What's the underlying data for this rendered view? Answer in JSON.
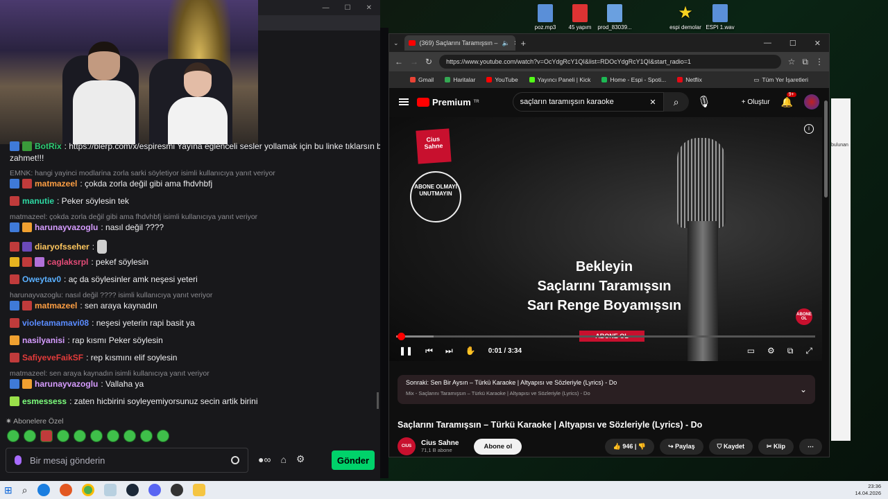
{
  "desktop_icons": [
    {
      "label": "poz.mp3",
      "color": "#5a8fd8"
    },
    {
      "label": "45 yapım",
      "color": "#d33"
    },
    {
      "label": "prod_83039...",
      "color": "#6aa0e0"
    },
    {
      "label": "espi demolar",
      "color": "#f5d020"
    },
    {
      "label": "ESPI 1.wav",
      "color": "#5a8fd8"
    }
  ],
  "chat": {
    "messages": [
      {
        "user": "BotRix",
        "user_color": "#2ecc71",
        "text": ": https://blerp.com/x/espiresmi  Yayına eğlenceli sesler yollamak için bu linke tıklarsın bi"
      },
      {
        "user": "",
        "user_color": "#efeff1",
        "text": "zahmet!!!"
      },
      {
        "reply": "EMNK: hangi yayinci modlarina zorla sarki söyletiyor     isimli kullanıcıya yanıt veriyor"
      },
      {
        "user": "matmazeel",
        "user_color": "#ff9f43",
        "text": ": çokda zorla değil gibi ama fhdvhbfj"
      },
      {
        "user": "manutie",
        "user_color": "#2ed8a3",
        "text": ": Peker söylesin tek"
      },
      {
        "reply": "matmazeel: çokda zorla değil gibi ama fhdvhbfj isimli kullanıcıya yanıt veriyor"
      },
      {
        "user": "harunayvazoglu",
        "user_color": "#d69cff",
        "text": ": nasıl değil ????"
      },
      {
        "user": "diaryofsseher",
        "user_color": "#ffc75f",
        "text": ":"
      },
      {
        "user": "caglaksrpl",
        "user_color": "#e54c78",
        "text": ": pekef söylesin"
      },
      {
        "user": "Oweytav0",
        "user_color": "#5ab0ff",
        "text": ": aç da söylesinler amk neşesi yeteri"
      },
      {
        "reply": "harunayvazoglu: nasıl değil ???? isimli kullanıcıya yanıt veriyor"
      },
      {
        "user": "matmazeel",
        "user_color": "#ff9f43",
        "text": ": sen araya kaynadın"
      },
      {
        "user": "violetamamavi08",
        "user_color": "#5a8cff",
        "text": ": neşesi yeterin rapi basit ya"
      },
      {
        "user": "nasilyanisi",
        "user_color": "#d69cff",
        "text": ": rap kısmı Peker söylesin"
      },
      {
        "user": "SafiyeveFaikSF",
        "user_color": "#e53b3b",
        "text": ": rep kısmını elif soylesin"
      },
      {
        "reply": "matmazeel: sen araya kaynadın isimli kullanıcıya yanıt veriyor"
      },
      {
        "user": "harunayvazoglu",
        "user_color": "#d69cff",
        "text": ": Vallaha ya"
      },
      {
        "user": "esmessess",
        "user_color": "#7dff7d",
        "text": ": zaten hicbirini soyleyemiyorsunuz secin artik birini"
      }
    ],
    "abone_label": "Abonelere Özel",
    "input_placeholder": "Bir mesaj gönderin",
    "send_label": "Gönder"
  },
  "browser": {
    "tab_title": "(369) Saçlarını Taramışsın –",
    "url": "https://www.youtube.com/watch?v=OcYdgRcY1QI&list=RDOcYdgRcY1QI&start_radio=1",
    "bookmarks": [
      "Gmail",
      "Haritalar",
      "YouTube",
      "Yayıncı Paneli | Kick",
      "Home - Espi - Spoti...",
      "Netflix"
    ],
    "bookmarks_right": "Tüm Yer İşaretleri",
    "yt_premium": "Premium",
    "yt_region": "TR",
    "search_value": "saçların taramışsın karaoke",
    "create_label": "Oluştur",
    "notif_count": "9+",
    "player": {
      "cius_logo": "Cius Sahne",
      "abone_circle": "ABONE OLMAYI UNUTMAYIN",
      "lyric_lines": [
        "Bekleyin",
        "Saçlarını Taramışsın",
        "Sarı Renge Boyamışsın"
      ],
      "subscribe_overlay": "ABONE OL",
      "corner_badge": "ABONE OL",
      "time": "0:01 / 3:34",
      "progress": 0.005
    },
    "next": {
      "label": "Sonraki: Sen Bir Aysın – Türkü Karaoke | Altyapısı ve Sözleriyle (Lyrics) - Do",
      "mix": "Mix - Saçlarını Taramışsın – Türkü Karaoke | Altyapısı ve Sözleriyle (Lyrics) - Do"
    },
    "video_title": "Saçlarını Taramışsın – Türkü Karaoke | Altyapısı ve Sözleriyle (Lyrics) - Do",
    "channel_name": "Cius Sahne",
    "channel_subs": "71,1 B abone",
    "subscribe_label": "Abone ol",
    "likes": "946",
    "share": "Paylaş",
    "save": "Kaydet",
    "clip": "Klip"
  },
  "sidewin": {
    "text": "bulunan"
  },
  "taskbar": {
    "time": "23:36",
    "date": "14.04.2026"
  }
}
